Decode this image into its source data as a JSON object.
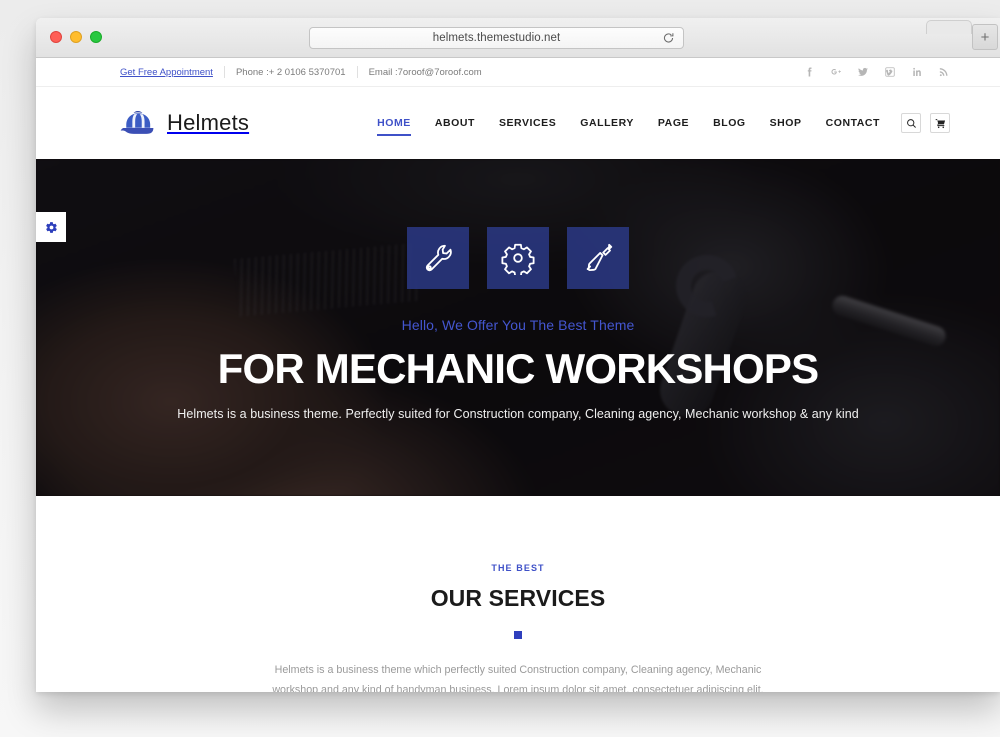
{
  "browser": {
    "url": "helmets.themestudio.net",
    "reload_label": "Reload",
    "newtab_label": "+",
    "window_controls": [
      "close",
      "minimize",
      "zoom"
    ]
  },
  "topbar": {
    "appointment_label": "Get Free Appointment",
    "phone": "Phone :+ 2 0106 5370701",
    "email": "Email :7oroof@7oroof.com",
    "social": [
      {
        "name": "facebook-icon",
        "label": "Facebook"
      },
      {
        "name": "google-plus-icon",
        "label": "Google Plus"
      },
      {
        "name": "twitter-icon",
        "label": "Twitter"
      },
      {
        "name": "vimeo-icon",
        "label": "Vimeo"
      },
      {
        "name": "linkedin-icon",
        "label": "LinkedIn"
      },
      {
        "name": "rss-icon",
        "label": "RSS"
      }
    ]
  },
  "header": {
    "brand_name": "Helmets",
    "logo_icon": "helmet-icon",
    "nav": [
      {
        "label": "HOME",
        "active": true
      },
      {
        "label": "ABOUT",
        "active": false
      },
      {
        "label": "SERVICES",
        "active": false
      },
      {
        "label": "GALLERY",
        "active": false
      },
      {
        "label": "PAGE",
        "active": false
      },
      {
        "label": "BLOG",
        "active": false
      },
      {
        "label": "SHOP",
        "active": false
      },
      {
        "label": "CONTACT",
        "active": false
      }
    ],
    "search_icon": "search-icon",
    "cart_icon": "cart-icon"
  },
  "hero": {
    "settings_icon": "gear-icon",
    "feature_icons": [
      {
        "name": "wrench-icon",
        "label": "Wrench"
      },
      {
        "name": "gear-icon",
        "label": "Gear"
      },
      {
        "name": "screwdriver-icon",
        "label": "Screwdriver"
      }
    ],
    "subtitle": "Hello, We Offer You The Best Theme",
    "title": "FOR MECHANIC WORKSHOPS",
    "description": "Helmets is a business theme. Perfectly suited for Construction company, Cleaning agency, Mechanic workshop & any kind"
  },
  "services": {
    "kicker": "THE BEST",
    "title": "OUR SERVICES",
    "description": "Helmets is a business theme which perfectly suited Construction company, Cleaning agency, Mechanic workshop and any kind of handyman business. Lorem ipsum dolor sit amet, consectetuer adipiscing elit."
  },
  "colors": {
    "accent_blue": "#3f51c8",
    "icon_box_blue": "#2a3882",
    "hero_dark": "#141010",
    "muted_text": "#9a9a9a"
  }
}
